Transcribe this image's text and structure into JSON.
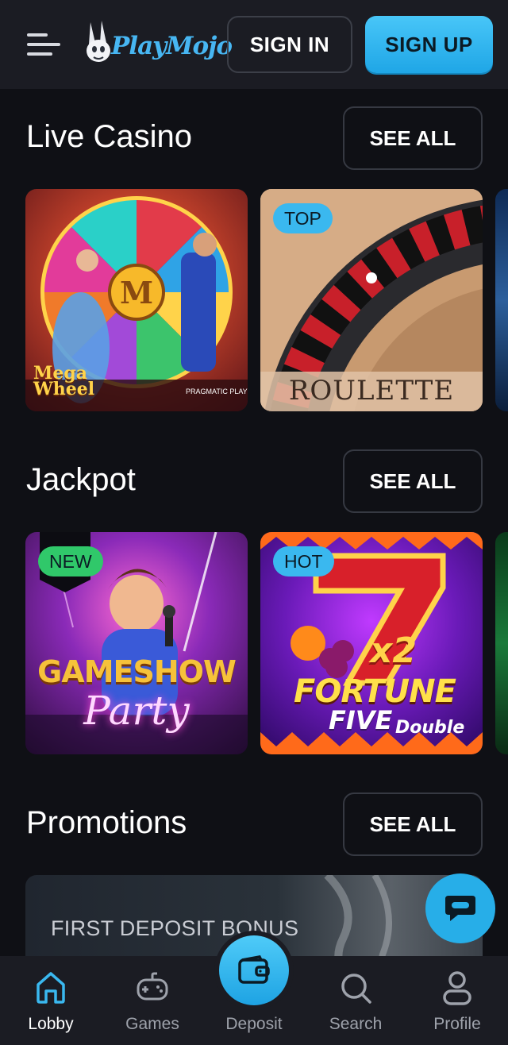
{
  "header": {
    "logo_text": "PlayMojo",
    "signin_label": "SIGN IN",
    "signup_label": "SIGN UP"
  },
  "sections": [
    {
      "title": "Live Casino",
      "see_all": "SEE ALL",
      "tiles": [
        {
          "name": "Mega Wheel",
          "badge": "",
          "provider": "PRAGMATIC PLAY"
        },
        {
          "name": "ROULETTE",
          "badge": "TOP"
        }
      ]
    },
    {
      "title": "Jackpot",
      "see_all": "SEE ALL",
      "tiles": [
        {
          "name_line1": "GAMESHOW",
          "name_line2": "Party",
          "badge": "NEW"
        },
        {
          "name_line1": "FORTUNE",
          "name_line2": "FIVE",
          "name_line3": "Double",
          "multiplier": "x2",
          "badge": "HOT"
        }
      ]
    },
    {
      "title": "Promotions",
      "see_all": "SEE ALL",
      "promo_text": "FIRST DEPOSIT BONUS"
    }
  ],
  "bottom_nav": [
    {
      "label": "Lobby",
      "icon": "home-icon",
      "active": true
    },
    {
      "label": "Games",
      "icon": "gamepad-icon",
      "active": false
    },
    {
      "label": "Deposit",
      "icon": "wallet-icon",
      "active": false
    },
    {
      "label": "Search",
      "icon": "search-icon",
      "active": false
    },
    {
      "label": "Profile",
      "icon": "profile-icon",
      "active": false
    }
  ],
  "colors": {
    "accent": "#27aee8",
    "background": "#0f1015",
    "panel": "#1b1c23",
    "badge_green": "#30c86a"
  }
}
